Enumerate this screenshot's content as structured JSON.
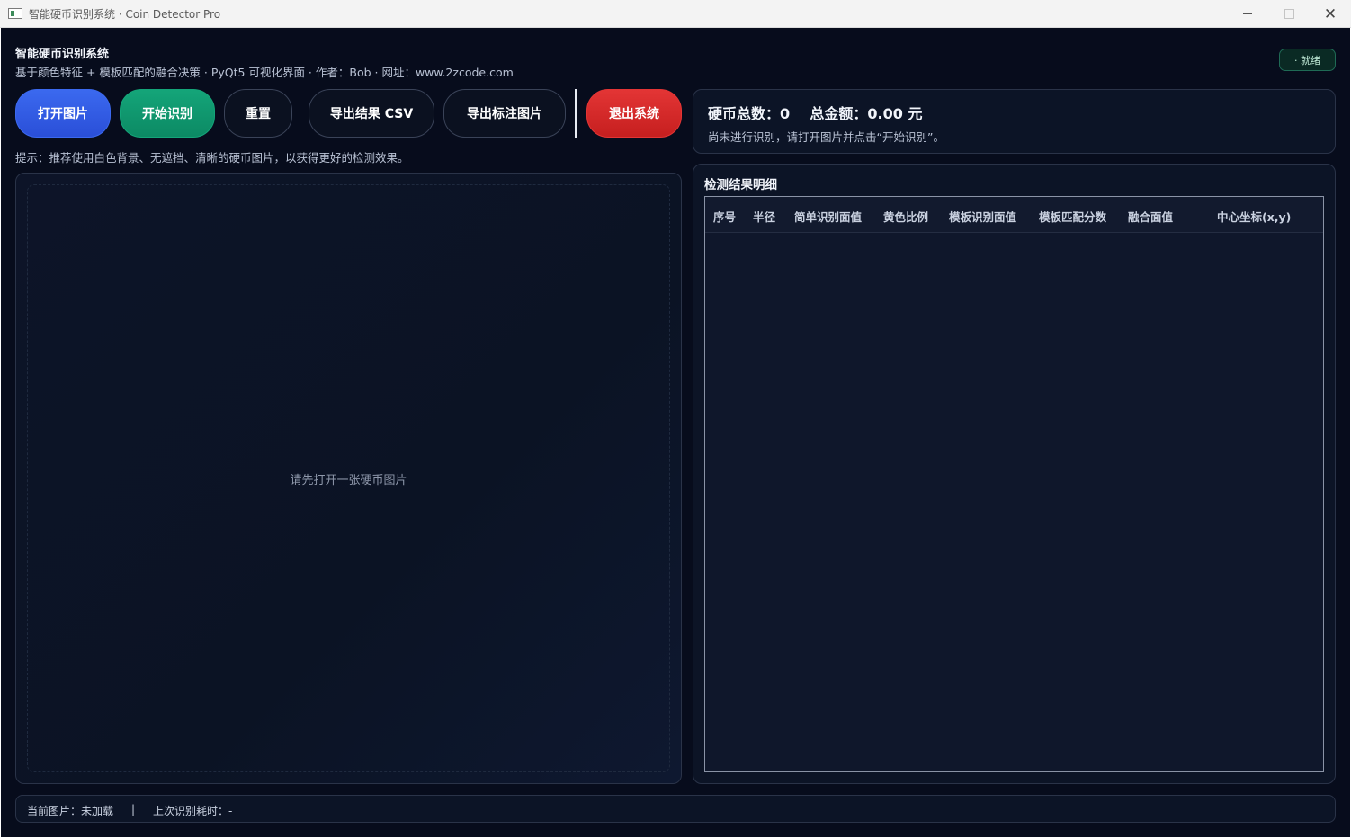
{
  "window": {
    "title": "智能硬币识别系统 · Coin Detector Pro",
    "close_glyph": "✕"
  },
  "header": {
    "title": "智能硬币识别系统",
    "subtitle": "基于颜色特征 + 模板匹配的融合决策 · PyQt5 可视化界面 · 作者：Bob · 网址：www.2zcode.com",
    "status": "· 就绪"
  },
  "toolbar": {
    "open_label": "打开图片",
    "start_label": "开始识别",
    "reset_label": "重置",
    "csv_label": "导出结果 CSV",
    "export_image_label": "导出标注图片",
    "exit_label": "退出系统"
  },
  "hint": "提示：推荐使用白色背景、无遮挡、清晰的硬币图片，以获得更好的检测效果。",
  "summary": {
    "totals": "硬币总数：0    总金额：0.00 元",
    "note": "尚未进行识别，请打开图片并点击“开始识别”。"
  },
  "image_panel": {
    "placeholder": "请先打开一张硬币图片"
  },
  "results": {
    "title": "检测结果明细",
    "columns": [
      "序号",
      "半径",
      "简单识别面值",
      "黄色比例",
      "模板识别面值",
      "模板匹配分数",
      "融合面值",
      "中心坐标(x,y)"
    ],
    "rows": []
  },
  "footer": {
    "current_image": "当前图片：未加载",
    "separator": "|",
    "last_time": "上次识别耗时：-"
  },
  "colors": {
    "background": "#070c1c",
    "open_button": "#2f5ae3",
    "start_button": "#10986e",
    "exit_button": "#d42a2a",
    "status_border": "#1f6a55"
  }
}
